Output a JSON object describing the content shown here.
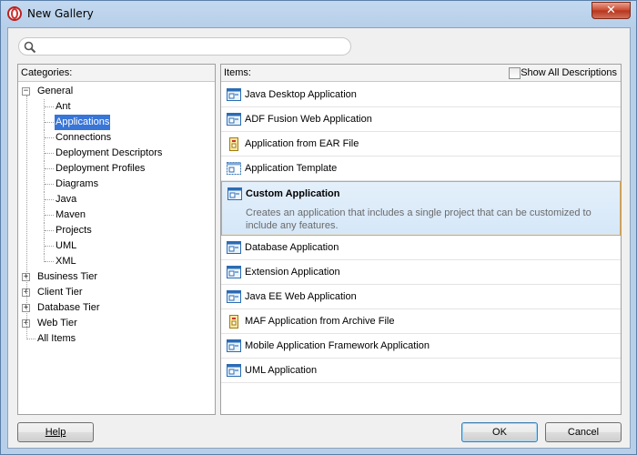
{
  "window": {
    "title": "New Gallery",
    "close_glyph": "✕"
  },
  "search": {
    "placeholder": "",
    "value": ""
  },
  "categories": {
    "header": "Categories:",
    "tree": [
      {
        "label": "General",
        "expanded": true,
        "children": [
          "Ant",
          "Applications",
          "Connections",
          "Deployment Descriptors",
          "Deployment Profiles",
          "Diagrams",
          "Java",
          "Maven",
          "Projects",
          "UML",
          "XML"
        ]
      },
      {
        "label": "Business Tier",
        "expanded": false
      },
      {
        "label": "Client Tier",
        "expanded": false
      },
      {
        "label": "Database Tier",
        "expanded": false
      },
      {
        "label": "Web Tier",
        "expanded": false
      },
      {
        "label": "All Items",
        "leaf": true
      }
    ],
    "selected": "Applications"
  },
  "items": {
    "header": "Items:",
    "show_all_label": "Show All Descriptions",
    "show_all_checked": false,
    "list": [
      {
        "label": "Java Desktop Application",
        "icon": "application-icon"
      },
      {
        "label": "ADF Fusion Web Application",
        "icon": "application-icon"
      },
      {
        "label": "Application from EAR File",
        "icon": "archive-icon"
      },
      {
        "label": "Application Template",
        "icon": "template-icon"
      },
      {
        "label": "Custom Application",
        "icon": "application-icon",
        "selected": true,
        "description": "Creates an application that includes a single project that can be customized to include any features."
      },
      {
        "label": "Database Application",
        "icon": "application-icon"
      },
      {
        "label": "Extension Application",
        "icon": "application-icon"
      },
      {
        "label": "Java EE Web Application",
        "icon": "application-icon"
      },
      {
        "label": "MAF Application from Archive File",
        "icon": "archive-icon"
      },
      {
        "label": "Mobile Application Framework Application",
        "icon": "application-icon"
      },
      {
        "label": "UML Application",
        "icon": "application-icon"
      }
    ]
  },
  "buttons": {
    "help": "Help",
    "ok": "OK",
    "cancel": "Cancel"
  },
  "colors": {
    "selection": "#3875d7",
    "highlight_border": "#e5a53a"
  }
}
